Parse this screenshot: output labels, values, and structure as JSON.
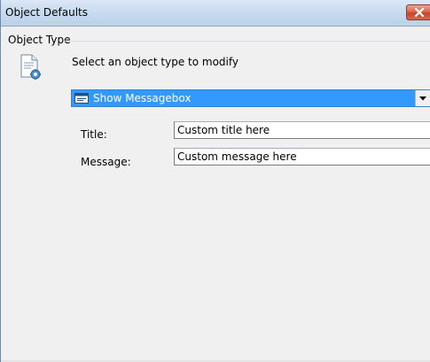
{
  "window": {
    "title": "Object Defaults"
  },
  "group": {
    "label": "Object Type"
  },
  "prompt": "Select an object type to modify",
  "object_type_select": {
    "selected": "Show Messagebox"
  },
  "fields": {
    "title": {
      "label": "Title:",
      "value": "Custom title here"
    },
    "message": {
      "label": "Message:",
      "value": "Custom message here"
    }
  },
  "icons": {
    "document": "document-gear-icon",
    "close": "close-icon",
    "dropdown_item": "messagebox-icon",
    "dropdown_arrow": "chevron-down-icon"
  },
  "colors": {
    "selection": "#3399ff",
    "close_button": "#c3452a",
    "titlebar": "#c8dbef"
  }
}
